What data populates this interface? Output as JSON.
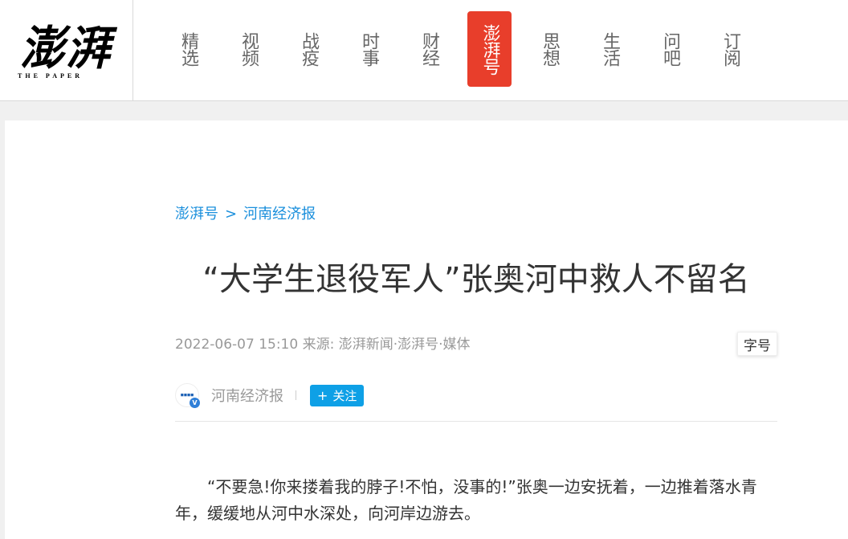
{
  "logo": {
    "cn": "澎湃",
    "en": "THE PAPER"
  },
  "nav": [
    {
      "label": "精选",
      "active": false
    },
    {
      "label": "视频",
      "active": false
    },
    {
      "label": "战疫",
      "active": false
    },
    {
      "label": "时事",
      "active": false
    },
    {
      "label": "财经",
      "active": false
    },
    {
      "label": "澎湃号",
      "active": true
    },
    {
      "label": "思想",
      "active": false
    },
    {
      "label": "生活",
      "active": false
    },
    {
      "label": "问吧",
      "active": false
    },
    {
      "label": "订阅",
      "active": false
    }
  ],
  "breadcrumb": {
    "parent": "澎湃号",
    "separator": ">",
    "current": "河南经济报"
  },
  "article": {
    "title": "“大学生退役军人”张奥河中救人不留名",
    "meta": "2022-06-07 15:10 来源: 澎湃新闻·澎湃号·媒体",
    "font_size_label": "字号",
    "author": {
      "name": "河南经济报",
      "badge": "V"
    },
    "follow_label": "关注",
    "follow_icon": "plus-icon",
    "paragraph": "“不要急!你来搂着我的脖子!不怕，没事的!”张奥一边安抚着，一边推着落水青年，缓缓地从河中水深处，向河岸边游去。"
  },
  "colors": {
    "accent_red": "#e83e2b",
    "link_blue": "#1a8fdc",
    "follow_blue": "#0ea0e6"
  }
}
